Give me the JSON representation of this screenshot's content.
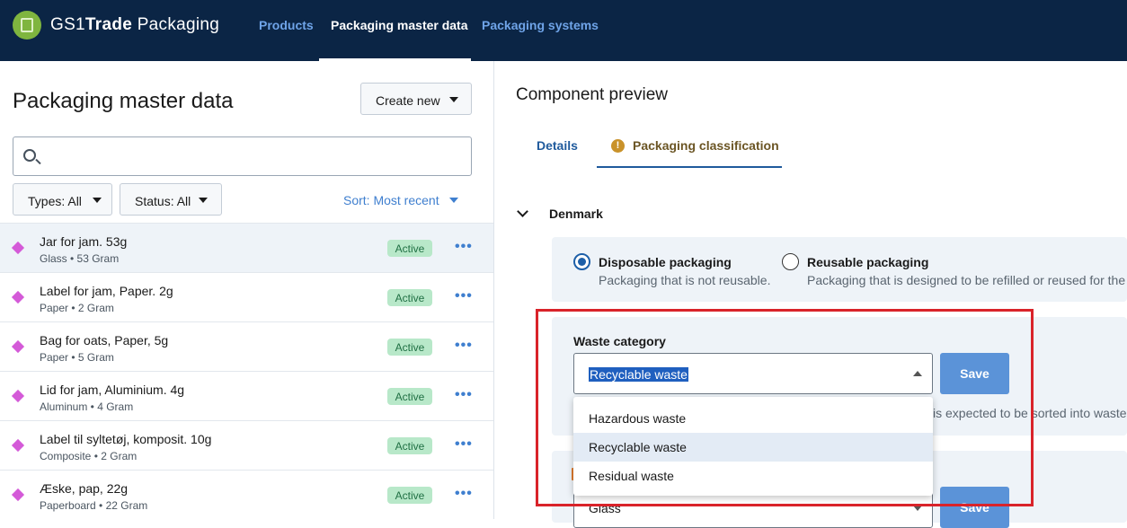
{
  "app": {
    "brand_prefix": "GS1",
    "brand_bold": "Trade",
    "brand_suffix": " Packaging"
  },
  "nav": {
    "items": [
      {
        "label": "Products",
        "active": false
      },
      {
        "label": "Packaging master data",
        "active": true
      },
      {
        "label": "Packaging systems",
        "active": false
      }
    ]
  },
  "left": {
    "title": "Packaging master data",
    "create_label": "Create new",
    "search_value": "",
    "filters": [
      {
        "label": "Types: All"
      },
      {
        "label": "Status: All"
      }
    ],
    "sort_label": "Sort: Most recent",
    "items": [
      {
        "name": "Jar for jam. 53g",
        "meta": "Glass • 53 Gram",
        "status": "Active",
        "selected": true
      },
      {
        "name": "Label for jam, Paper. 2g",
        "meta": "Paper • 2 Gram",
        "status": "Active",
        "selected": false
      },
      {
        "name": "Bag for oats, Paper, 5g",
        "meta": "Paper • 5 Gram",
        "status": "Active",
        "selected": false
      },
      {
        "name": "Lid for jam, Aluminium. 4g",
        "meta": "Aluminum • 4 Gram",
        "status": "Active",
        "selected": false
      },
      {
        "name": "Label til syltetøj, komposit. 10g",
        "meta": "Composite • 2 Gram",
        "status": "Active",
        "selected": false
      },
      {
        "name": "Æske, pap, 22g",
        "meta": "Paperboard • 22 Gram",
        "status": "Active",
        "selected": false
      }
    ],
    "more_glyph": "•••"
  },
  "right": {
    "title": "Component preview",
    "tabs": [
      {
        "label": "Details",
        "active": false
      },
      {
        "label": "Packaging classification",
        "active": true,
        "warning_glyph": "!"
      }
    ],
    "country": "Denmark",
    "packaging_options": [
      {
        "label": "Disposable packaging",
        "description": "Packaging that is not reusable.",
        "selected": true
      },
      {
        "label": "Reusable packaging",
        "description": "Packaging that is designed to be refilled or reused for the",
        "selected": false
      }
    ],
    "waste": {
      "label": "Waste category",
      "value": "Recyclable waste",
      "save_label": "Save",
      "help_text": "is expected to be sorted into waste t",
      "options": [
        {
          "label": "Hazardous waste",
          "highlighted": false
        },
        {
          "label": "Recyclable waste",
          "highlighted": true
        },
        {
          "label": "Residual waste",
          "highlighted": false
        }
      ]
    },
    "material": {
      "value": "Glass",
      "save_label": "Save"
    }
  },
  "colors": {
    "topbar": "#0b2545",
    "accent": "#1f5a9c",
    "badge_bg": "#b8e8c9",
    "diamond": "#d45ad8",
    "highlight_rect": "#d9232a"
  }
}
